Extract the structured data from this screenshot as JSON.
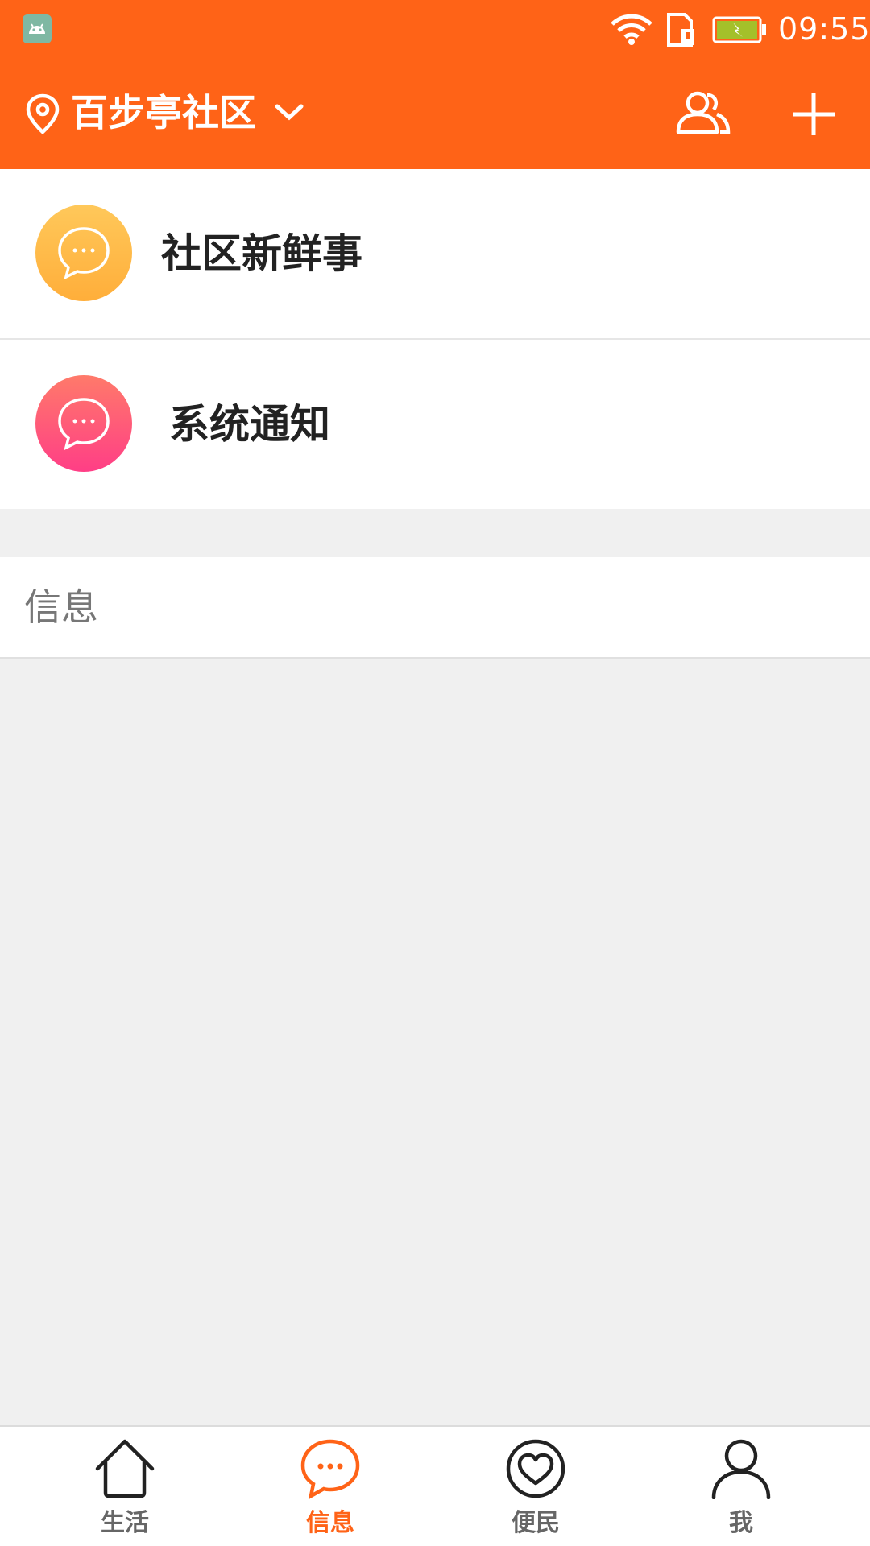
{
  "status_bar": {
    "time": "09:55",
    "icons": [
      "android-debug-icon",
      "wifi-icon",
      "sim-card-icon",
      "battery-charging-icon"
    ]
  },
  "app_bar": {
    "community_name": "百步亭社区",
    "icons": [
      "location-pin-icon",
      "chevron-down-icon",
      "group-icon",
      "plus-icon"
    ]
  },
  "rows": [
    {
      "label": "社区新鲜事",
      "icon": "chat-bubble-icon",
      "color": "#ffb84a"
    },
    {
      "label": "系统通知",
      "icon": "chat-bubble-icon",
      "color": "#ff4f7a"
    }
  ],
  "section": {
    "title": "信息"
  },
  "bottom_nav": {
    "items": [
      {
        "label": "生活",
        "icon": "home-icon",
        "active": false
      },
      {
        "label": "信息",
        "icon": "chat-bubble-icon",
        "active": true
      },
      {
        "label": "便民",
        "icon": "heart-circle-icon",
        "active": false
      },
      {
        "label": "我",
        "icon": "user-icon",
        "active": false
      }
    ]
  },
  "colors": {
    "accent": "#ff6317",
    "background": "#f0f0f0"
  }
}
